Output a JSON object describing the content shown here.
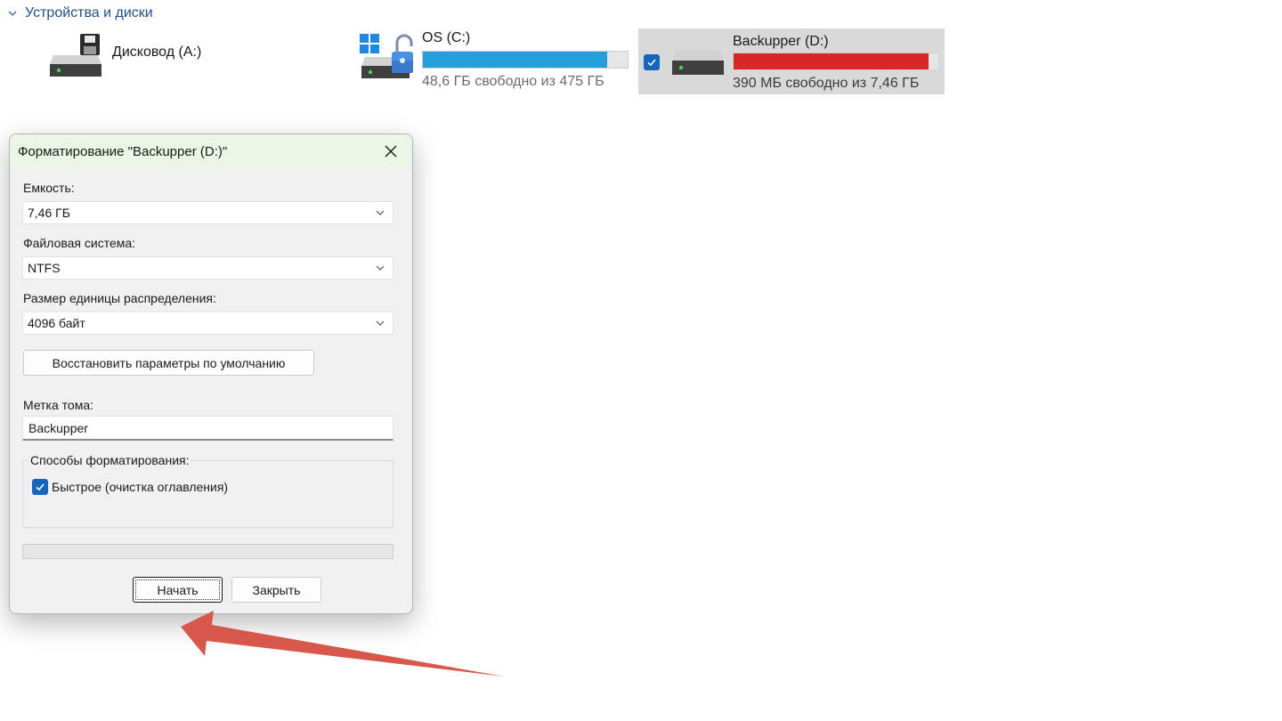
{
  "explorer": {
    "section_title": "Устройства и диски",
    "drives": [
      {
        "name": "Дисковод (A:)"
      },
      {
        "name": "OS (C:)",
        "free_text": "48,6 ГБ свободно из 475 ГБ",
        "used_fraction": 0.9,
        "bar_color": "#26a0da"
      },
      {
        "name": "Backupper (D:)",
        "free_text": "390 МБ свободно из 7,46 ГБ",
        "used_fraction": 0.95,
        "bar_color": "#da2626",
        "selected": true
      }
    ]
  },
  "dialog": {
    "title": "Форматирование \"Backupper (D:)\"",
    "capacity_label": "Емкость:",
    "capacity_value": "7,46 ГБ",
    "fs_label": "Файловая система:",
    "fs_value": "NTFS",
    "alloc_label": "Размер единицы распределения:",
    "alloc_value": "4096 байт",
    "restore_label": "Восстановить параметры по умолчанию",
    "volume_label_title": "Метка тома:",
    "volume_label_value": "Backupper",
    "format_options_title": "Способы форматирования:",
    "quick_format_label": "Быстрое (очистка оглавления)",
    "quick_format_checked": true,
    "progress_fraction": 0,
    "start_label": "Начать",
    "close_label": "Закрыть"
  },
  "colors": {
    "accent": "#1565c0",
    "arrow": "#d8574b"
  }
}
